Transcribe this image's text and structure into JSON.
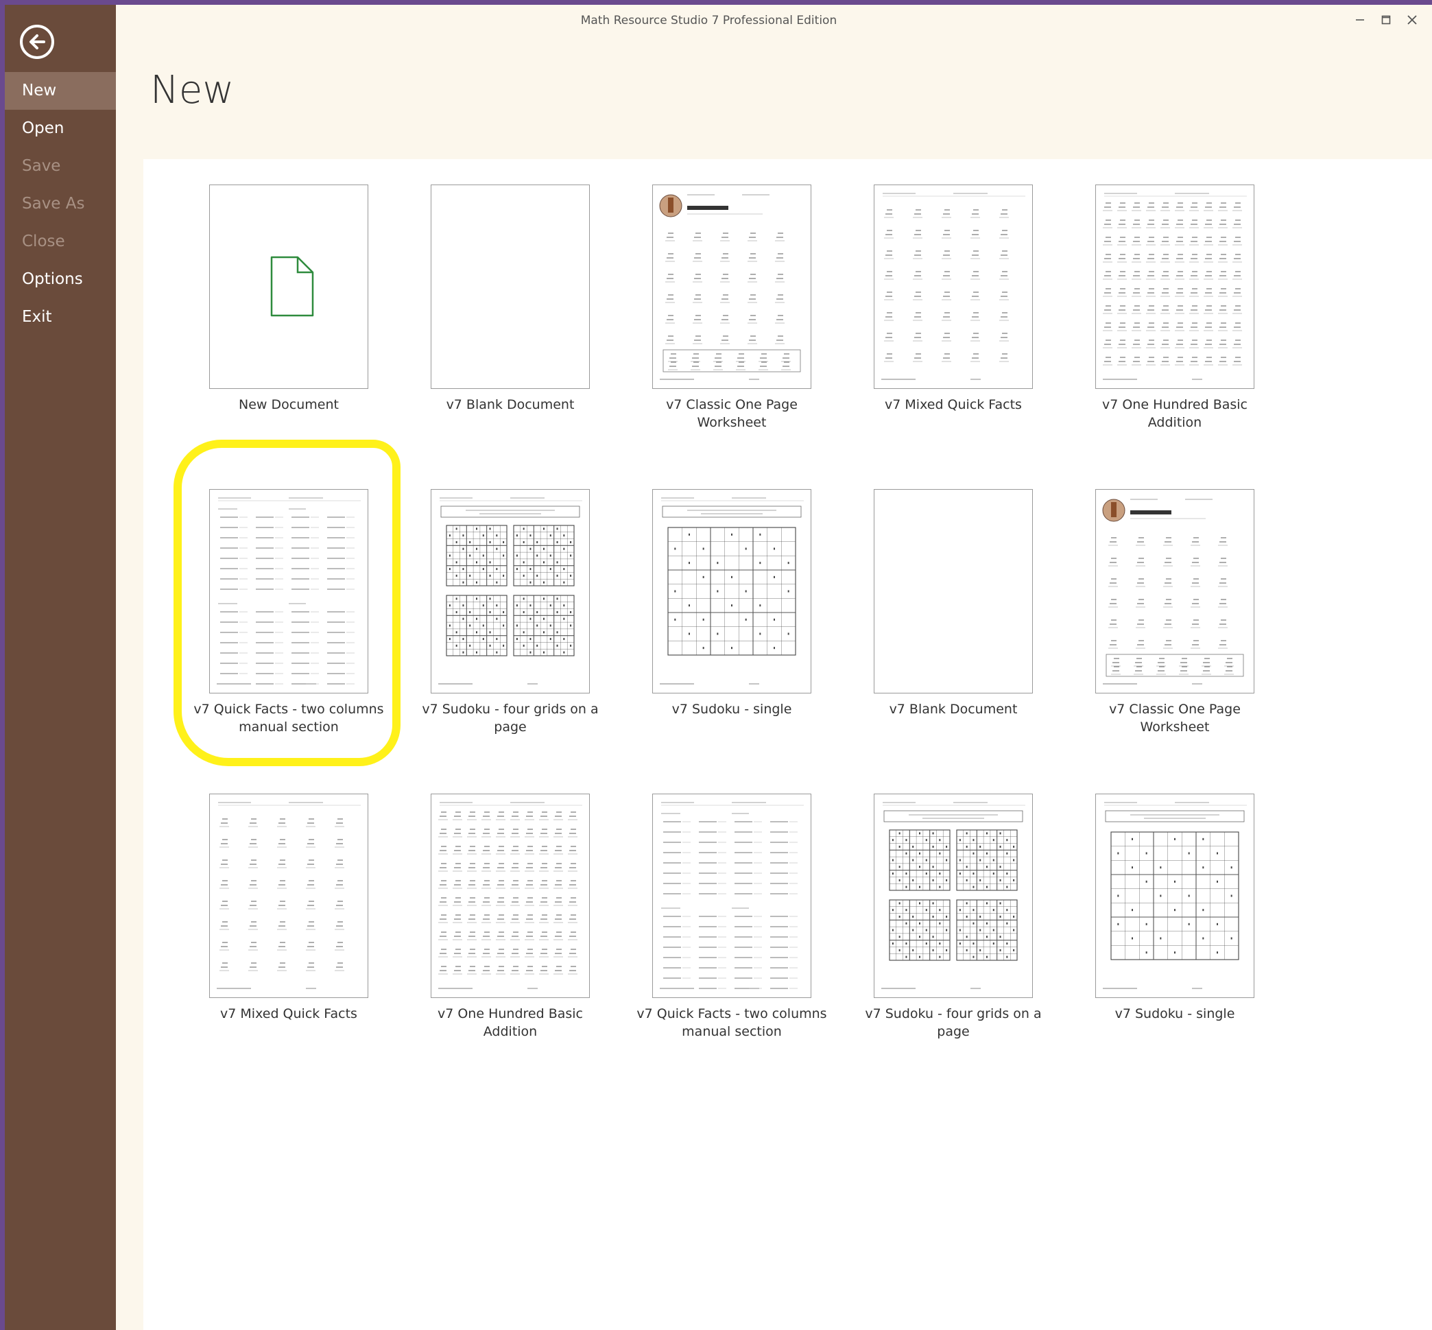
{
  "window": {
    "title": "Math Resource Studio 7 Professional Edition"
  },
  "sidebar": {
    "items": [
      {
        "label": "New",
        "state": "active"
      },
      {
        "label": "Open",
        "state": "normal"
      },
      {
        "label": "Save",
        "state": "disabled"
      },
      {
        "label": "Save As",
        "state": "disabled"
      },
      {
        "label": "Close",
        "state": "disabled"
      },
      {
        "label": "Options",
        "state": "normal"
      },
      {
        "label": "Exit",
        "state": "normal"
      }
    ]
  },
  "main": {
    "title": "New",
    "templates": [
      {
        "label": "New Document",
        "kind": "new-doc"
      },
      {
        "label": "v7 Blank Document",
        "kind": "blank"
      },
      {
        "label": "v7 Classic One Page Worksheet",
        "kind": "classic"
      },
      {
        "label": "v7 Mixed Quick Facts",
        "kind": "mixed"
      },
      {
        "label": "v7 One Hundred Basic Addition",
        "kind": "hundred"
      },
      {
        "label": "v7 Quick Facts - two columns manual section",
        "kind": "quick",
        "highlighted": true
      },
      {
        "label": "v7 Sudoku - four grids on a page",
        "kind": "sudoku4"
      },
      {
        "label": "v7 Sudoku - single",
        "kind": "sudoku1"
      },
      {
        "label": "v7 Blank Document",
        "kind": "blank"
      },
      {
        "label": "v7 Classic One Page Worksheet",
        "kind": "classic"
      },
      {
        "label": "v7 Mixed Quick Facts",
        "kind": "mixed"
      },
      {
        "label": "v7 One Hundred Basic Addition",
        "kind": "hundred"
      },
      {
        "label": "v7 Quick Facts - two columns manual section",
        "kind": "quick"
      },
      {
        "label": "v7 Sudoku - four grids on a page",
        "kind": "sudoku4"
      },
      {
        "label": "v7 Sudoku - single",
        "kind": "sudoku1"
      }
    ]
  },
  "colors": {
    "sidebar": "#6a4b3b",
    "sidebar_active": "#8a6d5e",
    "content_bg": "#fcf7ec",
    "highlight": "#fff11a",
    "new_doc_icon": "#2e8b3d"
  },
  "icons": {
    "back": "arrow-left-circle-icon",
    "new_document": "document-icon",
    "minimize": "minimize-icon",
    "maximize": "maximize-icon",
    "close": "close-icon"
  }
}
